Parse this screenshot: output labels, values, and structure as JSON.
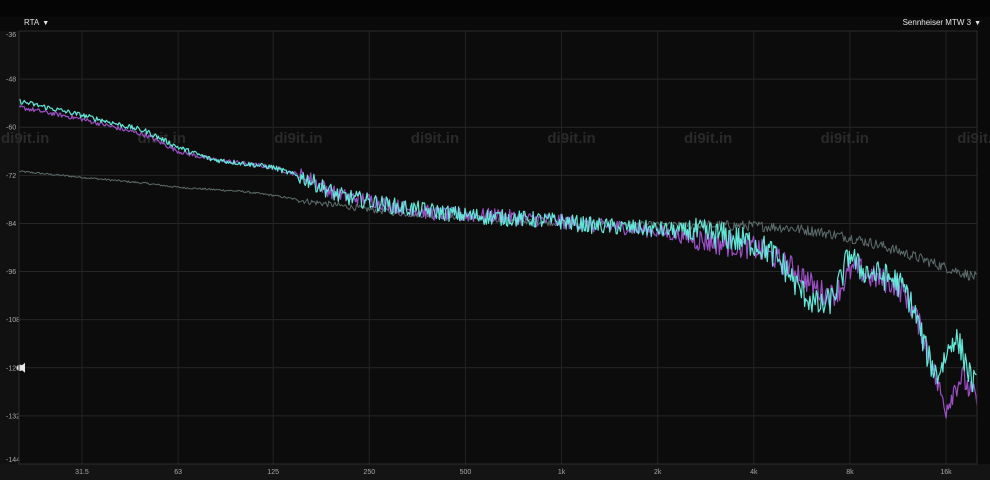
{
  "header": {
    "left_label": "RTA",
    "right_label": "Sennheiser MTW 3",
    "dropdown_glyph": "▼"
  },
  "watermark": "di9it.in",
  "chart_data": {
    "type": "line",
    "xscale": "log",
    "xlim": [
      20,
      20000
    ],
    "ylim": [
      -144,
      -36
    ],
    "xticks": [
      {
        "value": 31.5,
        "label": "31.5"
      },
      {
        "value": 63,
        "label": "63"
      },
      {
        "value": 125,
        "label": "125"
      },
      {
        "value": 250,
        "label": "250"
      },
      {
        "value": 500,
        "label": "500"
      },
      {
        "value": 1000,
        "label": "1k"
      },
      {
        "value": 2000,
        "label": "2k"
      },
      {
        "value": 4000,
        "label": "4k"
      },
      {
        "value": 8000,
        "label": "8k"
      },
      {
        "value": 16000,
        "label": "16k"
      }
    ],
    "yticks": [
      -36,
      -48,
      -60,
      -72,
      -84,
      -96,
      -108,
      -120,
      -132,
      -144
    ],
    "reference_level": -120,
    "grid": true,
    "series": [
      {
        "color": "#5c6b6b",
        "noise": 0.6,
        "x": [
          20,
          31.5,
          50,
          63,
          100,
          125,
          160,
          200,
          250,
          315,
          400,
          500,
          630,
          800,
          1000,
          1250,
          1600,
          2000,
          2500,
          3150,
          4000,
          5000,
          6300,
          8000,
          10000,
          12500,
          16000,
          20000
        ],
        "y": [
          -71,
          -72.5,
          -74,
          -75,
          -76,
          -77,
          -78.5,
          -79.5,
          -80.5,
          -81.5,
          -82,
          -82.5,
          -83,
          -83.5,
          -84,
          -84,
          -84.2,
          -84.3,
          -84.4,
          -84.5,
          -84.6,
          -85,
          -86,
          -87.5,
          -89.5,
          -92,
          -95,
          -97.5
        ]
      },
      {
        "color": "#9b4fc4",
        "noise": 1.4,
        "x": [
          20,
          31.5,
          50,
          63,
          80,
          100,
          125,
          160,
          200,
          250,
          315,
          400,
          500,
          630,
          800,
          1000,
          1250,
          1600,
          2000,
          2500,
          3150,
          4000,
          4500,
          5000,
          5500,
          6000,
          6500,
          7000,
          7500,
          8000,
          8500,
          9000,
          10000,
          11000,
          12000,
          13000,
          14000,
          15000,
          16000,
          17000,
          18000,
          19000,
          20000
        ],
        "y": [
          -55,
          -58,
          -62,
          -66,
          -68,
          -69,
          -70,
          -72.5,
          -77,
          -78,
          -80,
          -81.5,
          -82,
          -82,
          -83,
          -83.5,
          -84.5,
          -85,
          -86,
          -87.5,
          -89,
          -90,
          -92,
          -94,
          -96,
          -99,
          -101,
          -102,
          -100,
          -96,
          -95,
          -97,
          -98,
          -99,
          -102,
          -108,
          -115,
          -124,
          -130,
          -125,
          -122,
          -126,
          -128
        ]
      },
      {
        "color": "#62e8d8",
        "noise": 1.6,
        "x": [
          20,
          31.5,
          50,
          63,
          80,
          100,
          125,
          160,
          200,
          250,
          315,
          400,
          500,
          630,
          800,
          1000,
          1250,
          1600,
          2000,
          2500,
          3150,
          4000,
          4500,
          5000,
          5500,
          6000,
          6500,
          7000,
          7500,
          8000,
          8500,
          9000,
          10000,
          11000,
          12000,
          13000,
          14000,
          15000,
          16000,
          17000,
          18000,
          19000,
          20000
        ],
        "y": [
          -53.5,
          -57,
          -61,
          -65,
          -68,
          -69,
          -70,
          -73,
          -77,
          -78.5,
          -80,
          -81,
          -82,
          -82.5,
          -83,
          -83.5,
          -84.5,
          -85,
          -85.5,
          -86,
          -87,
          -89,
          -91,
          -95,
          -100,
          -103,
          -105,
          -103,
          -98,
          -91,
          -95,
          -96,
          -97,
          -98,
          -101,
          -108,
          -117,
          -122,
          -117,
          -112,
          -116,
          -122,
          -125
        ]
      }
    ]
  }
}
